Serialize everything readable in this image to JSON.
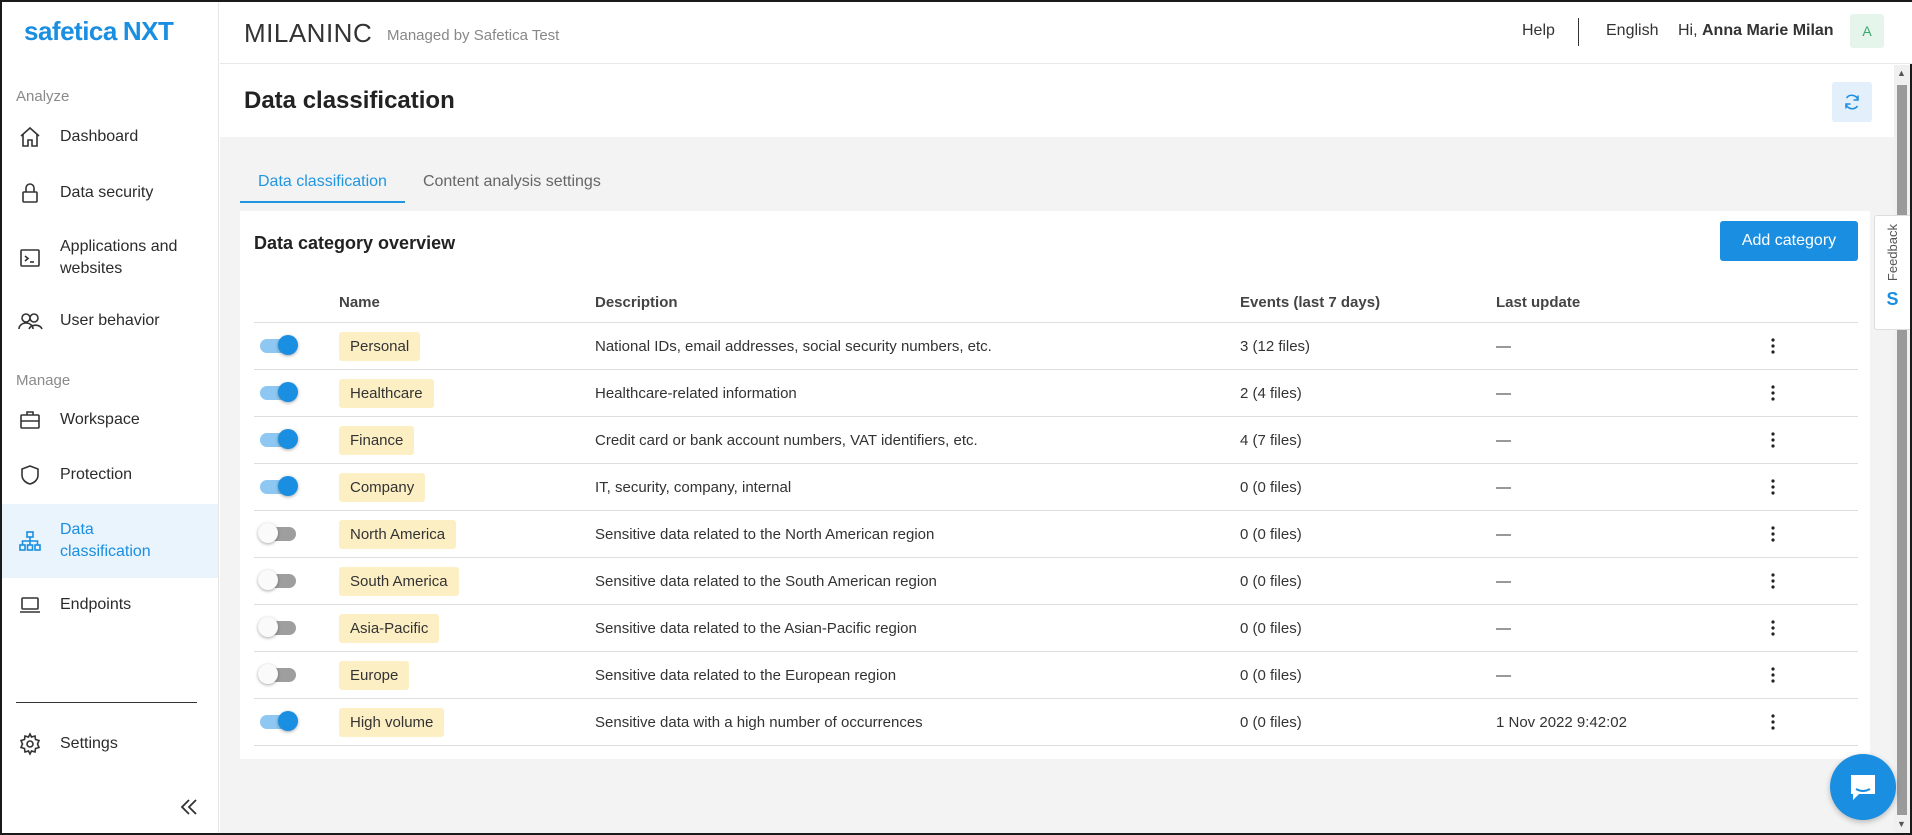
{
  "app": {
    "logo_main": "safetica",
    "logo_suffix": "NXT"
  },
  "sidebar": {
    "analyze_label": "Analyze",
    "manage_label": "Manage",
    "items": [
      {
        "label": "Dashboard",
        "icon": "home-icon"
      },
      {
        "label": "Data security",
        "icon": "lock-icon"
      },
      {
        "label": "Applications and websites",
        "icon": "terminal-window-icon"
      },
      {
        "label": "User behavior",
        "icon": "users-icon"
      },
      {
        "label": "Workspace",
        "icon": "briefcase-icon"
      },
      {
        "label": "Protection",
        "icon": "shield-icon"
      },
      {
        "label": "Data classification",
        "icon": "hierarchy-icon"
      },
      {
        "label": "Endpoints",
        "icon": "laptop-icon"
      }
    ],
    "settings_label": "Settings",
    "active_item": "Data classification"
  },
  "topbar": {
    "org_name": "MILANINC",
    "managed_by": "Managed by Safetica Test",
    "help": "Help",
    "language": "English",
    "greeting_prefix": "Hi, ",
    "user_name": "Anna Marie Milan",
    "avatar_initial": "A"
  },
  "page": {
    "title": "Data classification",
    "tabs": [
      {
        "label": "Data classification",
        "active": true
      },
      {
        "label": "Content analysis settings",
        "active": false
      }
    ]
  },
  "card": {
    "title": "Data category overview",
    "add_button": "Add category",
    "columns": {
      "name": "Name",
      "description": "Description",
      "events": "Events (last 7 days)",
      "last_update": "Last update"
    },
    "rows": [
      {
        "enabled": true,
        "name": "Personal",
        "description": "National IDs, email addresses, social security numbers, etc.",
        "events": "3 (12 files)",
        "last_update": "—"
      },
      {
        "enabled": true,
        "name": "Healthcare",
        "description": "Healthcare-related information",
        "events": "2 (4 files)",
        "last_update": "—"
      },
      {
        "enabled": true,
        "name": "Finance",
        "description": "Credit card or bank account numbers, VAT identifiers, etc.",
        "events": "4 (7 files)",
        "last_update": "—"
      },
      {
        "enabled": true,
        "name": "Company",
        "description": "IT, security, company, internal",
        "events": "0 (0 files)",
        "last_update": "—"
      },
      {
        "enabled": false,
        "name": "North America",
        "description": "Sensitive data related to the North American region",
        "events": "0 (0 files)",
        "last_update": "—"
      },
      {
        "enabled": false,
        "name": "South America",
        "description": "Sensitive data related to the South American region",
        "events": "0 (0 files)",
        "last_update": "—"
      },
      {
        "enabled": false,
        "name": "Asia-Pacific",
        "description": "Sensitive data related to the Asian-Pacific region",
        "events": "0 (0 files)",
        "last_update": "—"
      },
      {
        "enabled": false,
        "name": "Europe",
        "description": "Sensitive data related to the European region",
        "events": "0 (0 files)",
        "last_update": "—"
      },
      {
        "enabled": true,
        "name": "High volume",
        "description": "Sensitive data with a high number of occurrences",
        "events": "0 (0 files)",
        "last_update": "1 Nov 2022 9:42:02"
      }
    ]
  },
  "feedback": {
    "label": "Feedback",
    "logo": "S"
  },
  "colors": {
    "accent": "#1a8ee0",
    "tag_bg": "#fdefc4",
    "active_nav_bg": "#eaf4fc"
  }
}
